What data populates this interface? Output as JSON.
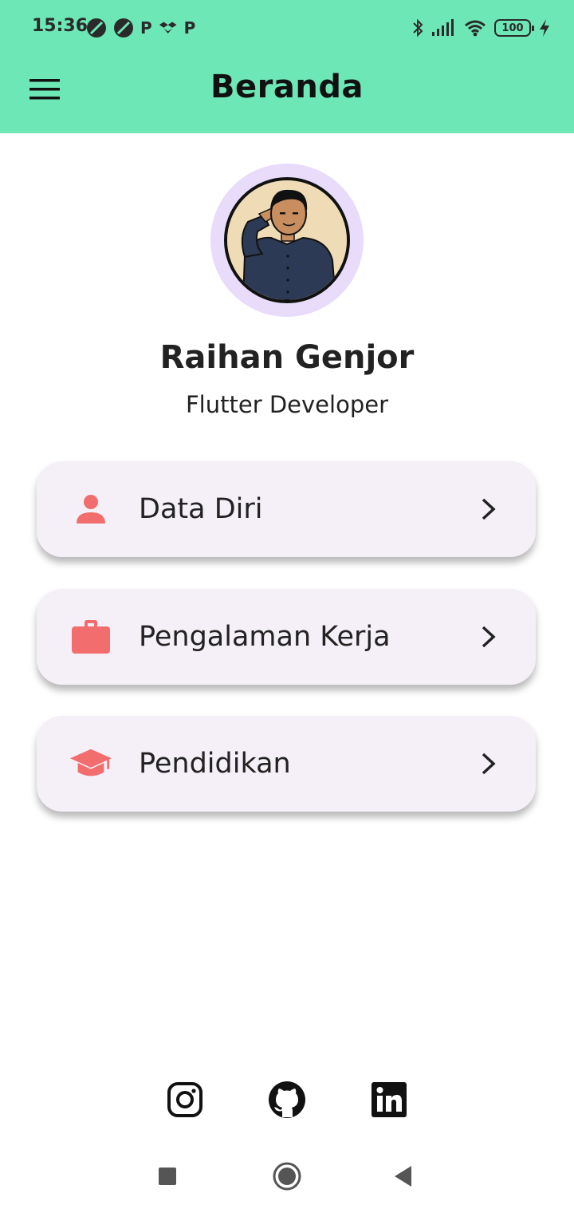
{
  "status_bar": {
    "time": "15:36",
    "left_icons": [
      "notification-icon",
      "notification-icon",
      "p-app-icon",
      "dropbox-icon",
      "p-app-icon"
    ],
    "p_glyph": "P",
    "battery_level": "100"
  },
  "app_bar": {
    "title": "Beranda",
    "background": "#6ee7b7"
  },
  "profile": {
    "name": "Raihan Genjor",
    "role": "Flutter Developer"
  },
  "menu": {
    "items": [
      {
        "label": "Data Diri",
        "icon": "person-icon"
      },
      {
        "label": "Pengalaman Kerja",
        "icon": "briefcase-icon"
      },
      {
        "label": "Pendidikan",
        "icon": "graduation-cap-icon"
      }
    ],
    "icon_color": "#f26d6d",
    "card_color": "#f5f0f8"
  },
  "socials": [
    "instagram-icon",
    "github-icon",
    "linkedin-icon"
  ],
  "nav_bar": [
    "recents-button",
    "home-button",
    "back-button"
  ]
}
